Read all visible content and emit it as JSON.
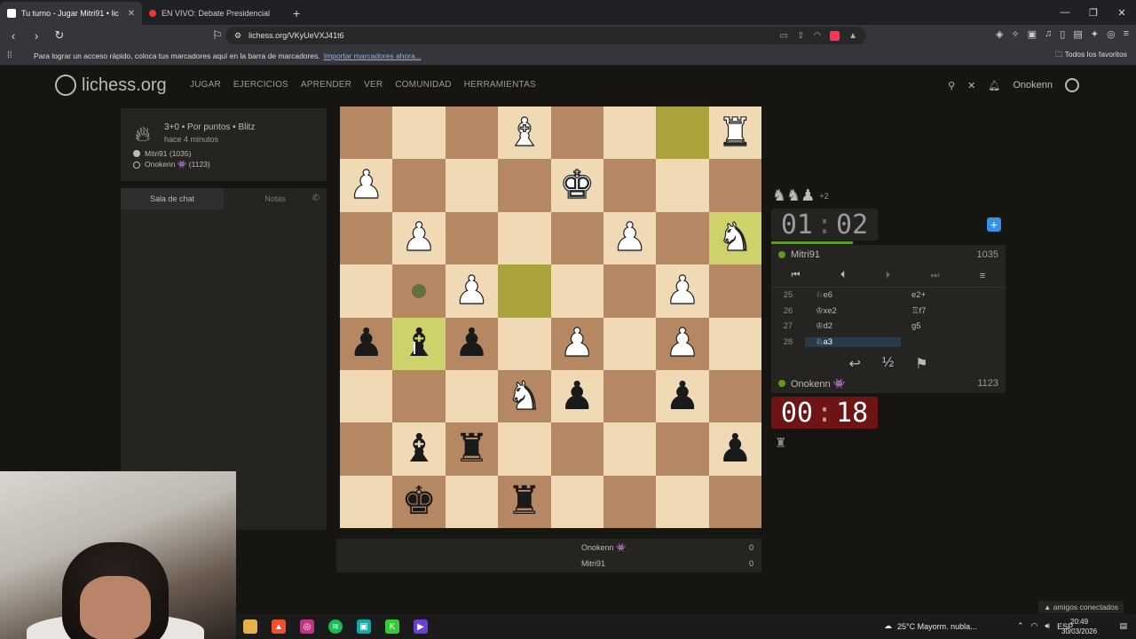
{
  "browser": {
    "tabs": [
      {
        "title": "Tu turno - Jugar Mitri91 • lic"
      },
      {
        "title": "EN VIVO: Debate Presidencial"
      }
    ],
    "new_tab": "+",
    "url": "lichess.org/VKyUeVXJ41t6",
    "bookmarks_message": "Para lograr un acceso rápido, coloca tus marcadores aquí en la barra de marcadores.",
    "bookmarks_import": "Importar marcadores ahora...",
    "bookmarks_favorites": "Todos los favoritos"
  },
  "site": {
    "logo": "lichess.org",
    "nav": [
      "JUGAR",
      "EJERCICIOS",
      "APRENDER",
      "VER",
      "COMUNIDAD",
      "HERRAMIENTAS"
    ],
    "username": "Onokenn"
  },
  "game_info": {
    "title": "3+0 • Por puntos • Blitz",
    "time": "hace 4 minutos",
    "white": "Mitri91 (1035)",
    "black": "Onokenn 👾 (1123)"
  },
  "chat": {
    "tab_chat": "Sala de chat",
    "tab_notes": "Notas"
  },
  "board": {
    "orientation": "black",
    "highlight_squares": [
      "b1",
      "a3",
      "e4",
      "g5"
    ],
    "move_dot": "g4",
    "pieces": [
      {
        "sq": "e1",
        "glyph": "♝",
        "color": "white"
      },
      {
        "sq": "a1",
        "glyph": "♜",
        "color": "white"
      },
      {
        "sq": "h2",
        "glyph": "♟",
        "color": "white"
      },
      {
        "sq": "d2",
        "glyph": "♚",
        "color": "white"
      },
      {
        "sq": "g3",
        "glyph": "♟",
        "color": "white"
      },
      {
        "sq": "c3",
        "glyph": "♟",
        "color": "white"
      },
      {
        "sq": "a3",
        "glyph": "♞",
        "color": "white"
      },
      {
        "sq": "f4",
        "glyph": "♟",
        "color": "white"
      },
      {
        "sq": "b4",
        "glyph": "♟",
        "color": "white"
      },
      {
        "sq": "d5",
        "glyph": "♟",
        "color": "white"
      },
      {
        "sq": "b5",
        "glyph": "♟",
        "color": "white"
      },
      {
        "sq": "h5",
        "glyph": "♟",
        "color": "black"
      },
      {
        "sq": "g5",
        "glyph": "♝",
        "color": "black"
      },
      {
        "sq": "f5",
        "glyph": "♟",
        "color": "black"
      },
      {
        "sq": "e6",
        "glyph": "♞",
        "color": "white"
      },
      {
        "sq": "d6",
        "glyph": "♟",
        "color": "black"
      },
      {
        "sq": "b6",
        "glyph": "♟",
        "color": "black"
      },
      {
        "sq": "g7",
        "glyph": "♝",
        "color": "black"
      },
      {
        "sq": "f7",
        "glyph": "♜",
        "color": "black"
      },
      {
        "sq": "a7",
        "glyph": "♟",
        "color": "black"
      },
      {
        "sq": "g8",
        "glyph": "♚",
        "color": "black"
      },
      {
        "sq": "e8",
        "glyph": "♜",
        "color": "black"
      }
    ]
  },
  "material": {
    "top_name": "Onokenn 👾",
    "top_score": "0",
    "bottom_name": "Mitri91",
    "bottom_score": "0"
  },
  "right_panel": {
    "captured": "♞♞♟",
    "captured_plus": "+2",
    "top_clock_min": "01",
    "top_clock_sec": "02",
    "top_player": "Mitri91",
    "top_rating": "1035",
    "bottom_player": "Onokenn 👾",
    "bottom_rating": "1123",
    "bottom_clock_min": "00",
    "bottom_clock_sec": "18",
    "moves": [
      {
        "num": "25",
        "white": "♘e6",
        "black": "e2+"
      },
      {
        "num": "26",
        "white": "♔xe2",
        "black": "♖f7"
      },
      {
        "num": "27",
        "white": "♔d2",
        "black": "g5"
      },
      {
        "num": "28",
        "white": "♘a3",
        "black": ""
      }
    ],
    "draw": "½"
  },
  "taskbar": {
    "weather": "25°C  Mayorm. nubla...",
    "lang": "ESP",
    "time": "20:49",
    "date": "30/03/2026"
  },
  "friends": "▲ amigos conectados",
  "colors": {
    "light_square": "#f0d9b5",
    "dark_square": "#b58863",
    "highlight": "#cdd26a",
    "clock_low": "#6e1414",
    "online_green": "#629924"
  }
}
